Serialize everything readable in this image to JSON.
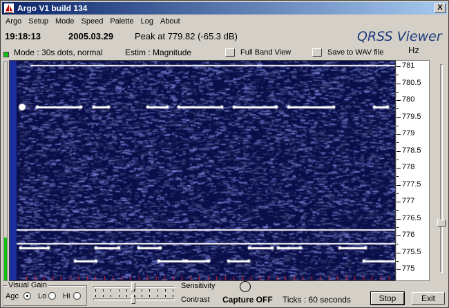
{
  "window": {
    "title": "Argo V1 build 134",
    "close_label": "X"
  },
  "menu": [
    "Argo",
    "Setup",
    "Mode",
    "Speed",
    "Palette",
    "Log",
    "About"
  ],
  "status": {
    "time": "19:18:13",
    "date": "2005.03.29",
    "peak": "Peak at  779.82 (-65.3 dB)",
    "mode": "Mode : 30s dots, normal",
    "estim": "Estim : Magnitude"
  },
  "brand": "QRSS Viewer",
  "axis_unit": "Hz",
  "options": {
    "full_band": "Full Band View",
    "save_wav": "Save to WAV file"
  },
  "axis_labels": [
    "781",
    "780.5",
    "780",
    "779.5",
    "779",
    "778.5",
    "778",
    "777.5",
    "777",
    "776.5",
    "776",
    "775.5",
    "775"
  ],
  "visual_gain": {
    "label": "Visual Gain",
    "agc": "Agc",
    "lo": "Lo",
    "hi": "Hi",
    "selected": "Agc"
  },
  "sliders": {
    "sensitivity": "Sensitivity",
    "contrast": "Contrast",
    "sensitivity_level": 0.5,
    "contrast_level": 0.5
  },
  "capture": "Capture OFF",
  "ticks": "Ticks  : 60 seconds",
  "buttons": {
    "stop": "Stop",
    "exit": "Exit"
  },
  "colors": {
    "waterfall_bg": "#0a0f4a",
    "signal": "#ffffff",
    "tick_marks": "#e02020",
    "level": "#10c010"
  }
}
